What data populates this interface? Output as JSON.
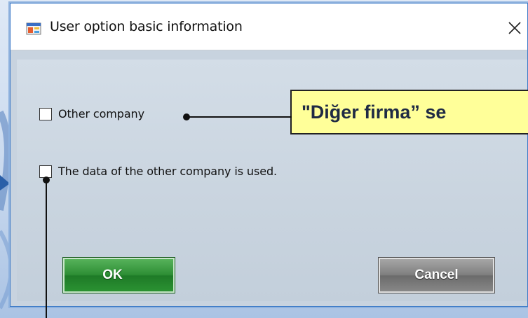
{
  "dialog": {
    "title": "User option basic information",
    "close_glyph": "✕"
  },
  "checkboxes": [
    {
      "label": "Other company",
      "checked": false
    },
    {
      "label": "The data of the other company is used.",
      "checked": false
    }
  ],
  "buttons": {
    "ok_label": "OK",
    "cancel_label": "Cancel"
  },
  "annotation": {
    "callout_text": "\"Diğer firma” se"
  },
  "colors": {
    "callout_fill": "#ffff99",
    "ok_green": "#2e8f35",
    "cancel_gray": "#808080",
    "window_border": "#3d7ac7"
  }
}
